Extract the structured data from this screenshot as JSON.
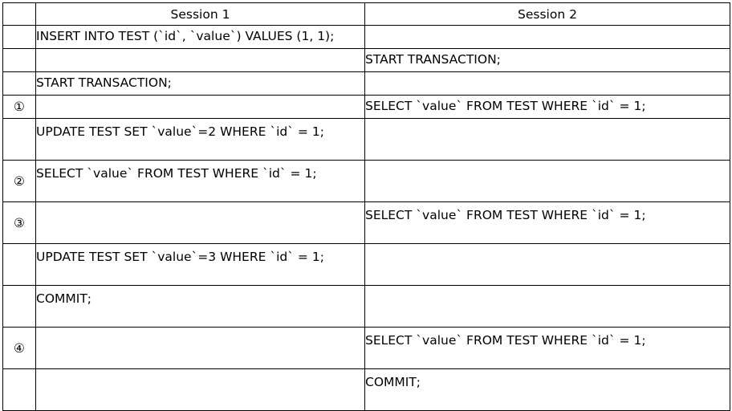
{
  "headers": {
    "step": "",
    "session1": "Session 1",
    "session2": "Session 2"
  },
  "rows": [
    {
      "step": "",
      "s1": "INSERT INTO TEST (`id`, `value`) VALUES (1, 1);",
      "s2": ""
    },
    {
      "step": "",
      "s1": "",
      "s2": "START TRANSACTION;"
    },
    {
      "step": "",
      "s1": "START TRANSACTION;",
      "s2": ""
    },
    {
      "step": "①",
      "s1": "",
      "s2": "SELECT `value` FROM TEST WHERE `id` = 1;"
    },
    {
      "step": "",
      "s1": "UPDATE TEST SET `value`=2 WHERE `id` = 1;",
      "s2": ""
    },
    {
      "step": "②",
      "s1": "SELECT `value` FROM TEST WHERE `id` = 1;",
      "s2": ""
    },
    {
      "step": "③",
      "s1": "",
      "s2": "SELECT `value` FROM TEST WHERE `id` = 1;"
    },
    {
      "step": "",
      "s1": "UPDATE TEST SET `value`=3 WHERE `id` = 1;",
      "s2": ""
    },
    {
      "step": "",
      "s1": "COMMIT;",
      "s2": ""
    },
    {
      "step": "④",
      "s1": "",
      "s2": "SELECT `value` FROM TEST WHERE `id` = 1;"
    },
    {
      "step": "",
      "s1": "",
      "s2": "COMMIT;"
    }
  ]
}
